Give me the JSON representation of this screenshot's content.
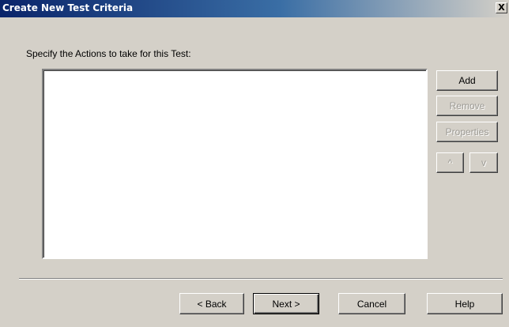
{
  "window": {
    "title": "Create New Test Criteria",
    "close_label": "X"
  },
  "main": {
    "instruction": "Specify the Actions to take for this Test:",
    "side_buttons": {
      "add": "Add",
      "remove": "Remove",
      "properties": "Properties",
      "move_up": "^",
      "move_down": "v"
    }
  },
  "footer": {
    "back": "< Back",
    "next": "Next >",
    "cancel": "Cancel",
    "help": "Help"
  }
}
